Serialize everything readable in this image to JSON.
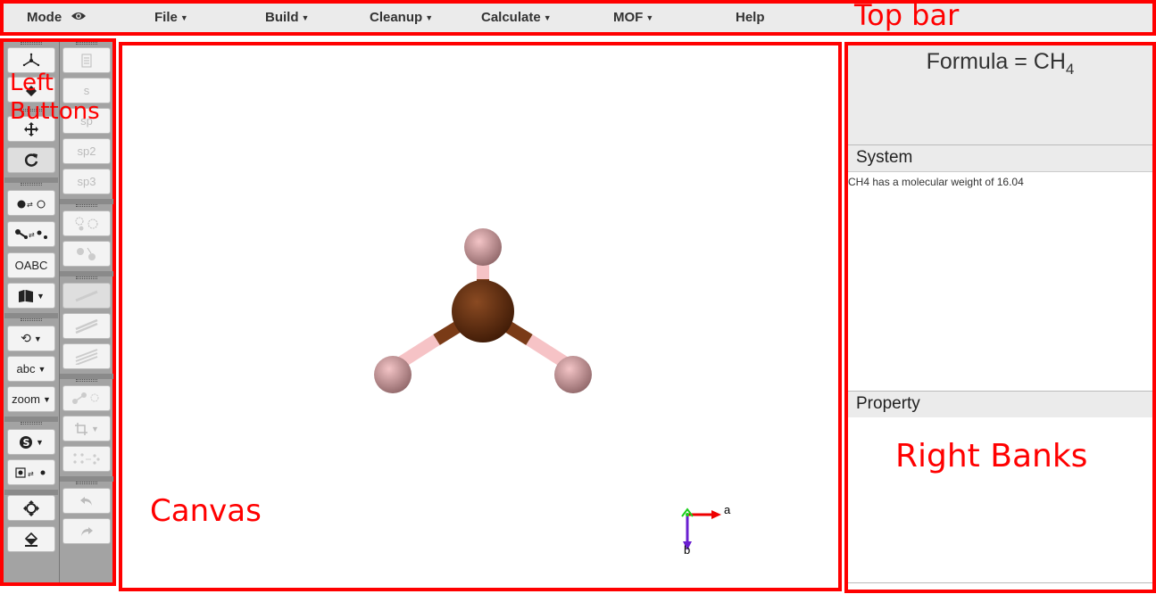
{
  "top_bar": {
    "mode_label": "Mode",
    "menu": [
      "File",
      "Build",
      "Cleanup",
      "Calculate",
      "MOF"
    ],
    "help_label": "Help",
    "annotation": "Top bar"
  },
  "left": {
    "annotation_line1": "Left",
    "annotation_line2": "Buttons",
    "col1_text": {
      "oabc": "OABC",
      "abc": "abc",
      "zoom": "zoom"
    },
    "col2_text": {
      "s": "s",
      "sp": "sp",
      "sp2": "sp2",
      "sp3": "sp3"
    }
  },
  "canvas": {
    "annotation": "Canvas",
    "axis_a": "a",
    "axis_b": "b",
    "atom_colors": {
      "carbon": "#5a2d12",
      "hydrogen": "#e8aeb0",
      "bond_c": "#7a3b17",
      "bond_h": "#f6c3c6"
    }
  },
  "right": {
    "formula_prefix": "Formula =  CH",
    "formula_subscript": "4",
    "system_title": "System",
    "system_text": "CH4  has a molecular weight of 16.04",
    "property_title": "Property",
    "annotation": "Right Banks"
  },
  "colors": {
    "annotation_red": "#ff0000",
    "panel_gray": "#ebebeb"
  }
}
